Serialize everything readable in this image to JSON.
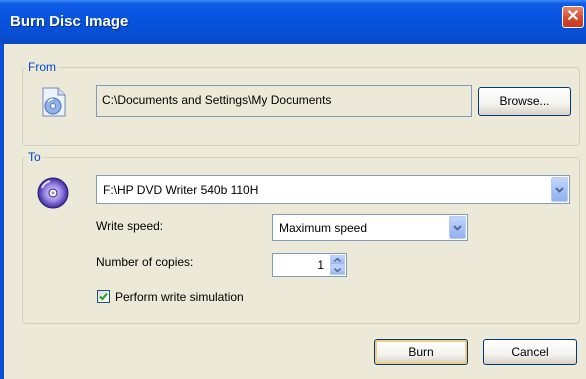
{
  "window": {
    "title": "Burn Disc Image",
    "close_glyph": "✕"
  },
  "from": {
    "legend": "From",
    "icon": "disc-image-file-icon",
    "path": "C:\\Documents and Settings\\My Documents",
    "browse_label": "Browse..."
  },
  "to": {
    "legend": "To",
    "icon": "dvd-disc-icon",
    "drive": "F:\\HP DVD Writer 540b 110H",
    "write_speed_label": "Write speed:",
    "write_speed": "Maximum speed",
    "copies_label": "Number of copies:",
    "copies": "1",
    "simulation_label": "Perform write simulation",
    "simulation_checked": true
  },
  "buttons": {
    "burn": "Burn",
    "cancel": "Cancel"
  },
  "colors": {
    "titlebar": "#0754e0",
    "legend": "#0046d5",
    "dialog": "#ece9d8"
  }
}
